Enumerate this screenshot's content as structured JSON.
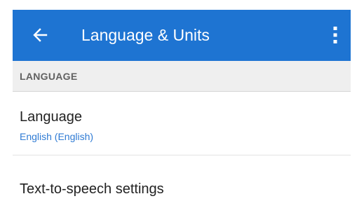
{
  "colors": {
    "appbar_background": "#1e74d2",
    "appbar_text": "#ffffff",
    "section_background": "#efefef",
    "section_text": "#616161",
    "summary_text": "#2f7bd4"
  },
  "appbar": {
    "back_icon": "arrow-back-icon",
    "title": "Language & Units",
    "overflow_icon": "more-vert-icon"
  },
  "sections": [
    {
      "header": "LANGUAGE",
      "items": [
        {
          "title": "Language",
          "summary": "English (English)"
        },
        {
          "title": "Text-to-speech settings"
        }
      ]
    }
  ]
}
